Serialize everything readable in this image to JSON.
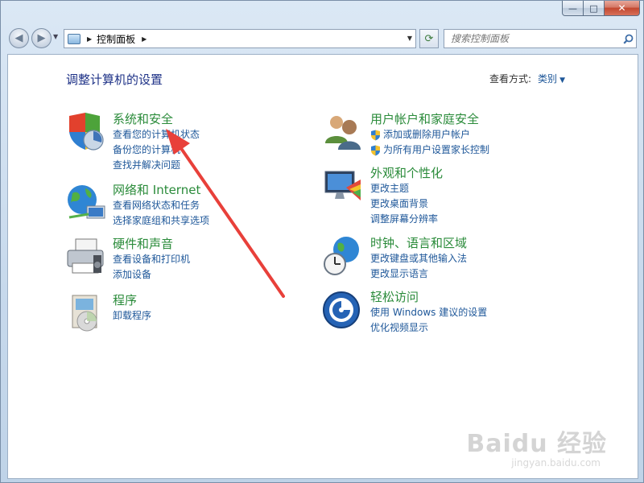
{
  "window": {
    "title_buttons": {
      "minimize": "—",
      "maximize": "□",
      "close": "✕"
    }
  },
  "nav": {
    "address_path": "控制面板",
    "search_placeholder": "搜索控制面板"
  },
  "content": {
    "title": "调整计算机的设置",
    "view_by_label": "查看方式:",
    "view_by_value": "类别"
  },
  "categories": [
    {
      "title": "系统和安全",
      "icon": "system-security-icon",
      "links": [
        "查看您的计算机状态",
        "备份您的计算机",
        "查找并解决问题"
      ]
    },
    {
      "title": "网络和 Internet",
      "icon": "network-internet-icon",
      "links": [
        "查看网络状态和任务",
        "选择家庭组和共享选项"
      ]
    },
    {
      "title": "硬件和声音",
      "icon": "hardware-sound-icon",
      "links": [
        "查看设备和打印机",
        "添加设备"
      ]
    },
    {
      "title": "程序",
      "icon": "programs-icon",
      "links": [
        "卸载程序"
      ]
    },
    {
      "title": "用户帐户和家庭安全",
      "icon": "user-accounts-icon",
      "links": [
        "添加或删除用户帐户",
        "为所有用户设置家长控制"
      ]
    },
    {
      "title": "外观和个性化",
      "icon": "appearance-icon",
      "links": [
        "更改主题",
        "更改桌面背景",
        "调整屏幕分辨率"
      ]
    },
    {
      "title": "时钟、语言和区域",
      "icon": "clock-language-icon",
      "links": [
        "更改键盘或其他输入法",
        "更改显示语言"
      ]
    },
    {
      "title": "轻松访问",
      "icon": "ease-of-access-icon",
      "links": [
        "使用 Windows 建议的设置",
        "优化视频显示"
      ]
    }
  ],
  "watermark": {
    "brand": "Baidu 经验",
    "url": "jingyan.baidu.com"
  },
  "colors": {
    "category_green": "#2a8b3a",
    "link_blue": "#1e5799",
    "title_blue": "#1e3287",
    "annotation_red": "#e8403a"
  }
}
